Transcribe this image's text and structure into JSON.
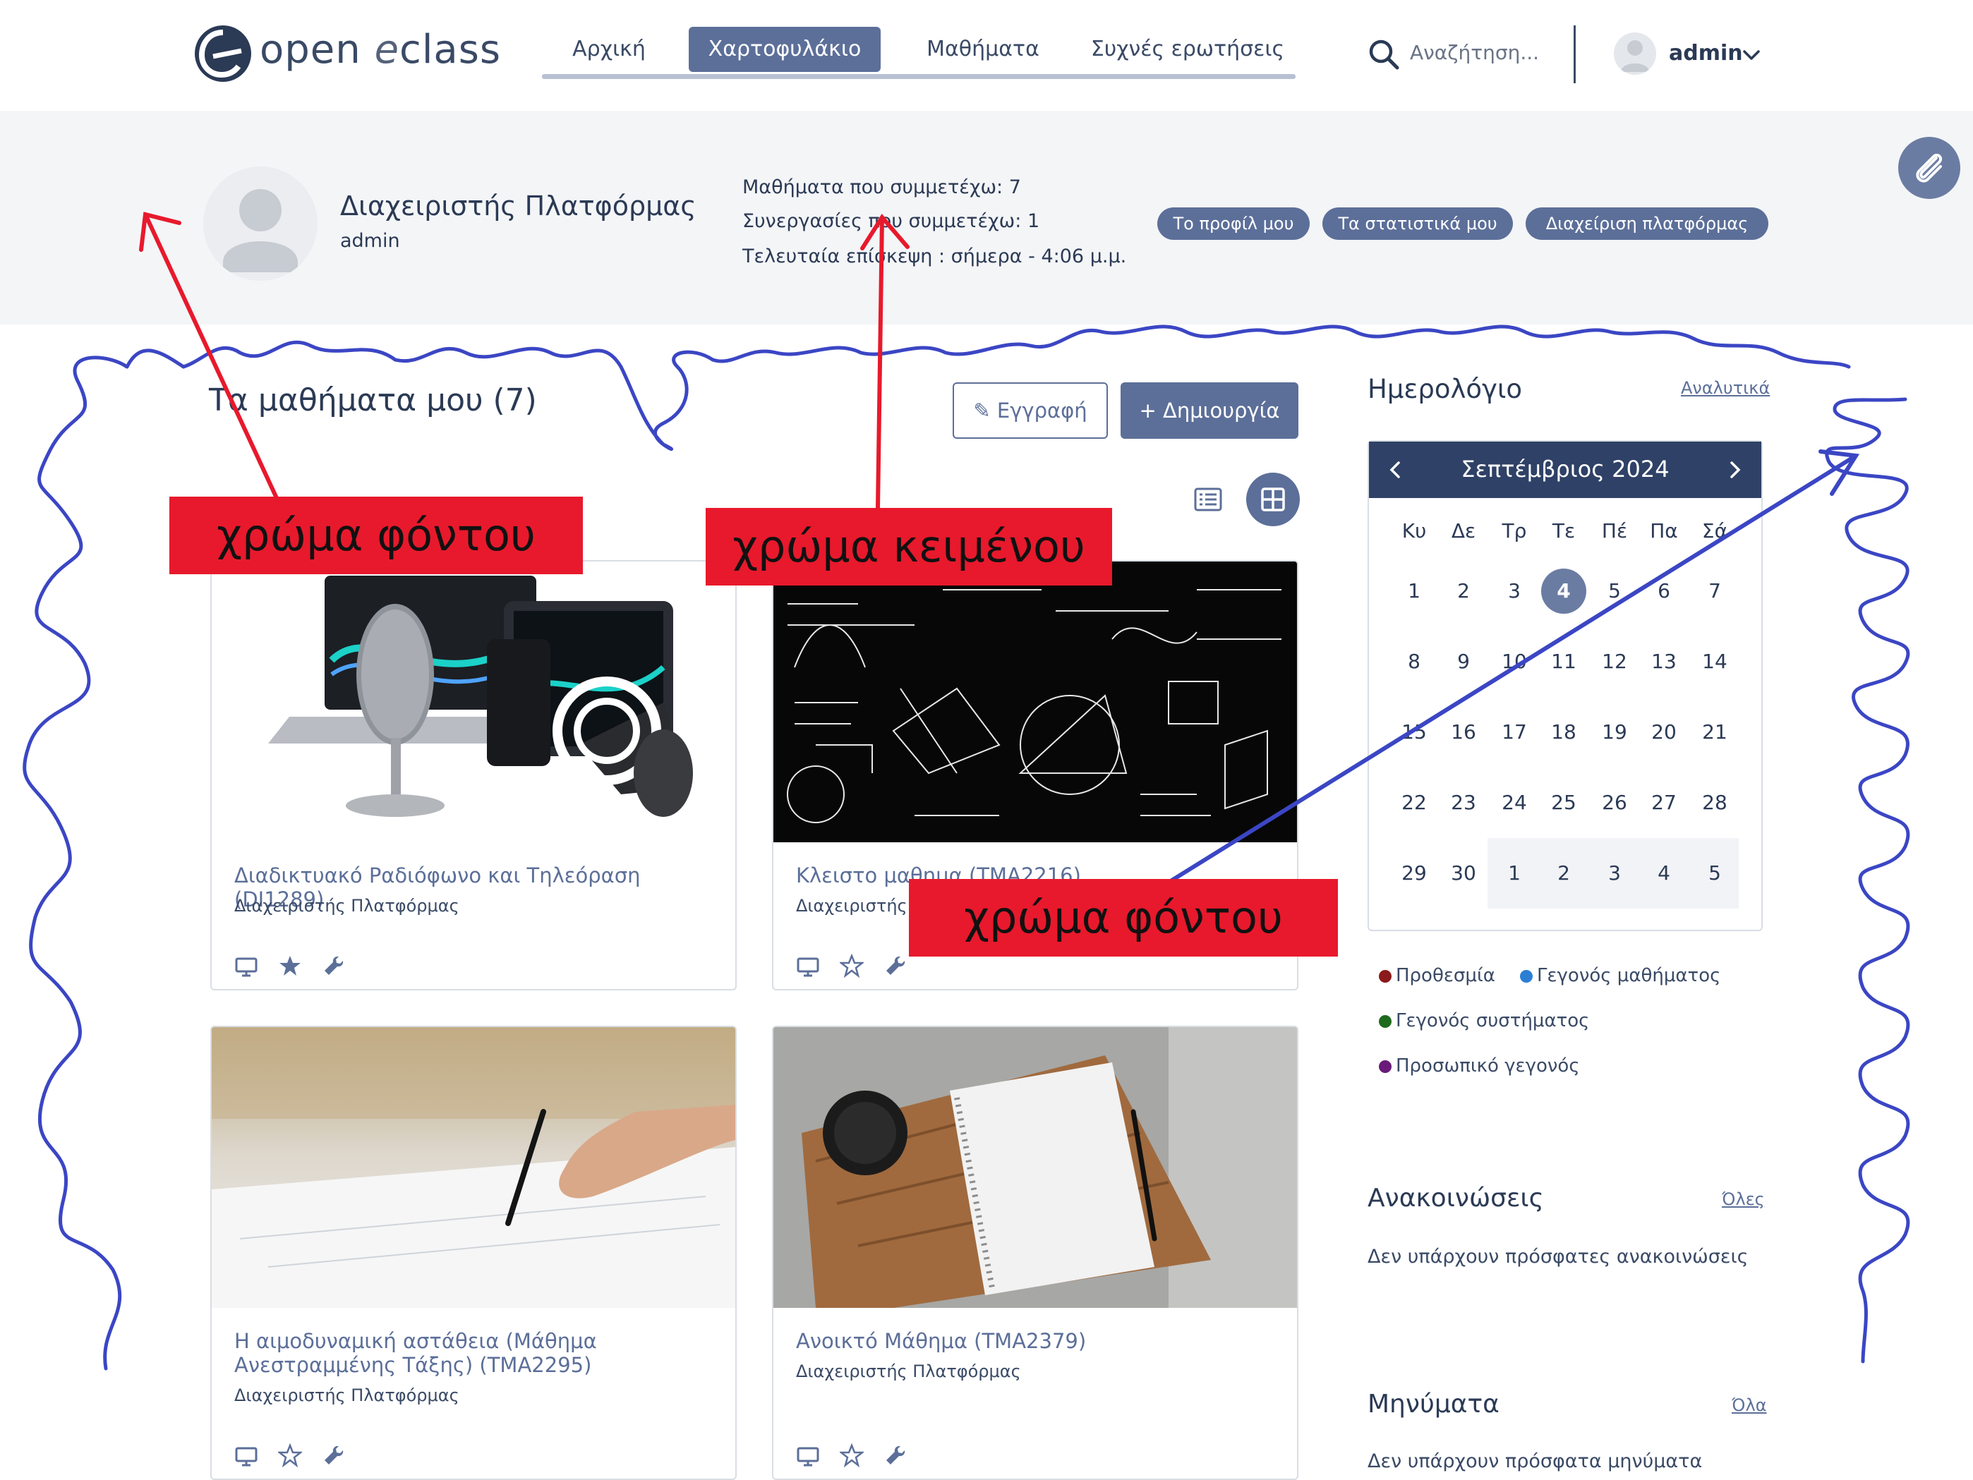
{
  "header": {
    "logo_text_a": "open",
    "logo_text_e": "e",
    "logo_text_b": "class",
    "nav": [
      {
        "label": "Αρχική",
        "active": false
      },
      {
        "label": "Χαρτοφυλάκιο",
        "active": true
      },
      {
        "label": "Μαθήματα",
        "active": false
      },
      {
        "label": "Συχνές ερωτήσεις",
        "active": false
      }
    ],
    "search_placeholder": "Αναζήτηση...",
    "user_name": "admin"
  },
  "profile": {
    "full_name": "Διαχειριστής Πλατφόρμας",
    "username": "admin",
    "stats": [
      "Μαθήματα που συμμετέχω: 7",
      "Συνεργασίες που συμμετέχω: 1",
      "Τελευταία επίσκεψη : σήμερα - 4:06 μ.μ."
    ],
    "buttons": [
      "Το προφίλ μου",
      "Τα στατιστικά μου",
      "Διαχείριση πλατφόρμας"
    ]
  },
  "courses": {
    "title": "Τα μαθήματα μου  (7)",
    "register_label": "Εγγραφή",
    "create_label": "Δημιουργία",
    "items": [
      {
        "title": "Διαδικτυακό Ραδιόφωνο και Τηλεόραση (DI1289)",
        "teacher": "Διαχειριστής Πλατφόρμας",
        "favorite": true,
        "image": "media-devices"
      },
      {
        "title": "Κλειστο μαθημα (TMA2216)",
        "teacher": "Διαχειριστής Πλατφόρμας",
        "favorite": false,
        "image": "blackboard-formulas"
      },
      {
        "title": "Η αιμοδυναμική αστάθεια (Μάθημα Ανεστραμμένης Τάξης) (TMA2295)",
        "teacher": "Διαχειριστής Πλατφόρμας",
        "favorite": false,
        "image": "hand-writing"
      },
      {
        "title": "Ανοικτό Μάθημα (TMA2379)",
        "teacher": "Διαχειριστής Πλατφόρμας",
        "favorite": false,
        "image": "notebook-coffee"
      }
    ]
  },
  "calendar": {
    "title": "Ημερολόγιο",
    "details_link": "Αναλυτικά",
    "month": "Σεπτέμβριος 2024",
    "weekdays": [
      "Κυ",
      "Δε",
      "Τρ",
      "Τε",
      "Πέ",
      "Πα",
      "Σά"
    ],
    "weeks": [
      [
        "1",
        "2",
        "3",
        "4",
        "5",
        "6",
        "7"
      ],
      [
        "8",
        "9",
        "10",
        "11",
        "12",
        "13",
        "14"
      ],
      [
        "15",
        "16",
        "17",
        "18",
        "19",
        "20",
        "21"
      ],
      [
        "22",
        "23",
        "24",
        "25",
        "26",
        "27",
        "28"
      ],
      [
        "29",
        "30",
        "1",
        "2",
        "3",
        "4",
        "5"
      ]
    ],
    "today": "4",
    "legend": [
      {
        "label": "Προθεσμία",
        "color": "#8b1a1a"
      },
      {
        "label": "Γεγονός μαθήματος",
        "color": "#2a7fd4"
      },
      {
        "label": "Γεγονός συστήματος",
        "color": "#1e6b1e"
      },
      {
        "label": "Προσωπικό γεγονός",
        "color": "#6a1b7a"
      }
    ]
  },
  "announcements": {
    "title": "Ανακοινώσεις",
    "link": "Όλες",
    "empty": "Δεν υπάρχουν πρόσφατες ανακοινώσεις"
  },
  "messages": {
    "title": "Μηνύματα",
    "link": "Όλα",
    "empty": "Δεν υπάρχουν πρόσφατα μηνύματα"
  },
  "annotations": {
    "labels": [
      "χρώμα φόντου",
      "χρώμα κειμένου",
      "χρώμα φόντου"
    ],
    "red_color": "#e8192c",
    "blue_color": "#3b46c4"
  },
  "colors": {
    "accent": "#5c6f99",
    "dark_header": "#2f4166",
    "band": "#f4f5f7"
  }
}
